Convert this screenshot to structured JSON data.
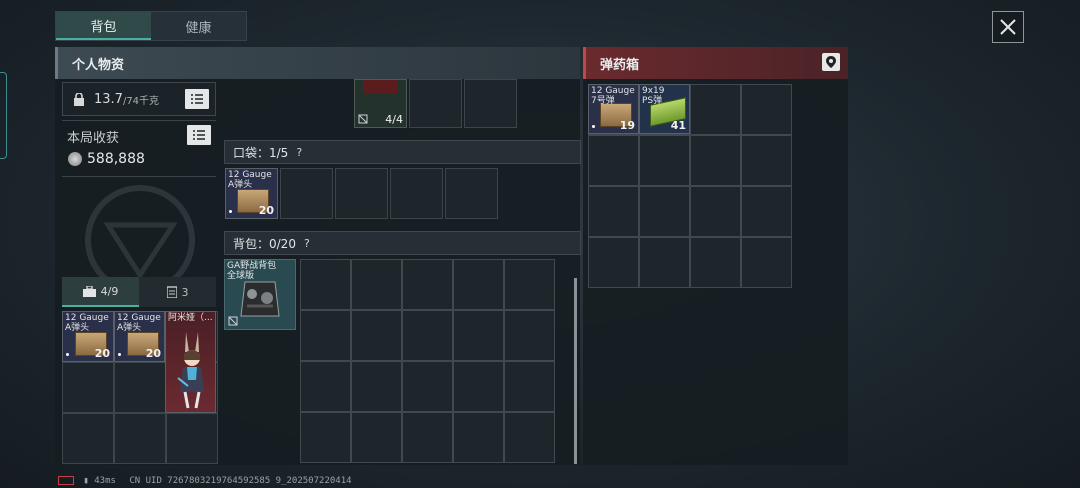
{
  "tabs": [
    {
      "label": "背包",
      "active": true
    },
    {
      "label": "健康",
      "active": false
    }
  ],
  "left_panel": {
    "title": "个人物资",
    "weight": {
      "value": "13.7",
      "capacity": "/74千克"
    },
    "session_loot": {
      "label": "本局收获",
      "amount": "588,888"
    },
    "safe_box": {
      "tab1_count": "4/9",
      "tab2_count": "3",
      "items": [
        {
          "name": "12 Gauge\nA弹头",
          "qty": "20"
        },
        {
          "name": "12 Gauge\nA弹头",
          "qty": "20"
        },
        {
          "name": "阿米娅（..."
        }
      ]
    }
  },
  "middle": {
    "top_item_count": "4/4",
    "pocket": {
      "label": "口袋：1/5",
      "help": "?",
      "item": {
        "name": "12 Gauge\nA弹头",
        "qty": "20"
      }
    },
    "backpack": {
      "label": "背包：0/20",
      "help": "?",
      "item": {
        "name": "GA野战背包\n全球版"
      }
    }
  },
  "right_panel": {
    "title": "弹药箱",
    "items": [
      {
        "name": "12 Gauge\n7号弹",
        "qty": "19"
      },
      {
        "name": "9x19\nPS弹",
        "qty": "41"
      }
    ]
  },
  "status_bar": {
    "ping": "43ms",
    "uid": "CN UID 7267803219764592585 9_202507220414"
  },
  "colors": {
    "accent": "#4ab0a0",
    "ammo_header": "#6a2a2e"
  }
}
